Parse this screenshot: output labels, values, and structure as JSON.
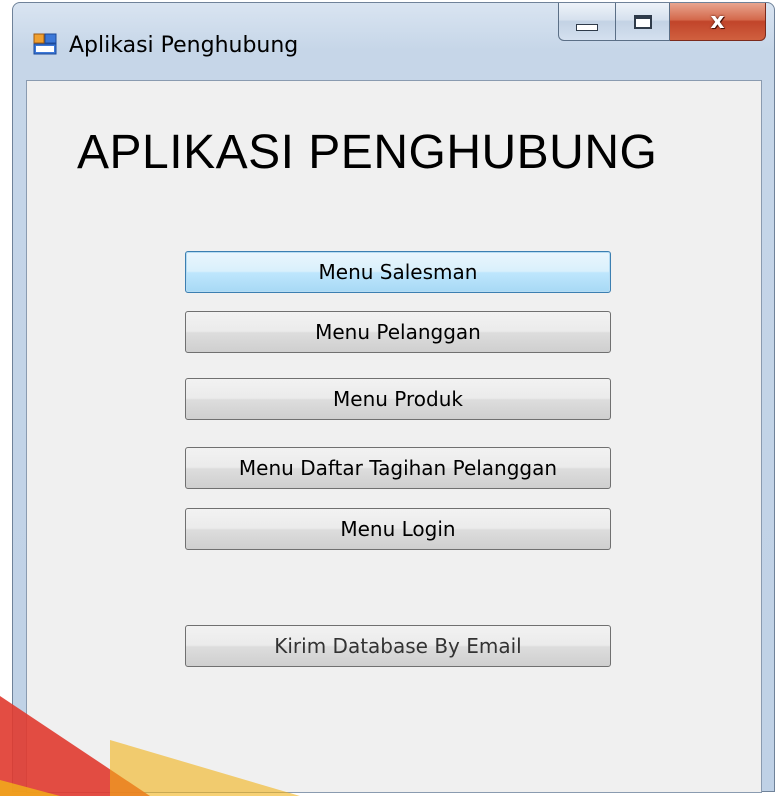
{
  "window": {
    "title": "Aplikasi Penghubung",
    "controls": {
      "minimize_icon": "minimize-icon",
      "maximize_icon": "maximize-icon",
      "close_icon": "close-icon",
      "close_glyph": "x"
    }
  },
  "form": {
    "heading": "APLIKASI PENGHUBUNG",
    "buttons": [
      {
        "label": "Menu Salesman",
        "focused": true
      },
      {
        "label": "Menu Pelanggan"
      },
      {
        "label": "Menu Produk"
      },
      {
        "label": "Menu Daftar Tagihan Pelanggan"
      },
      {
        "label": "Menu Login"
      },
      {
        "label": "Kirim Database By Email"
      }
    ]
  },
  "colors": {
    "titlebar": "#c6d6e8",
    "client_bg": "#f0f0f0",
    "close_button": "#c1442a",
    "focus_border": "#3c7fb1",
    "watermark_red": "#e03a2f",
    "watermark_yellow": "#f2b318"
  }
}
